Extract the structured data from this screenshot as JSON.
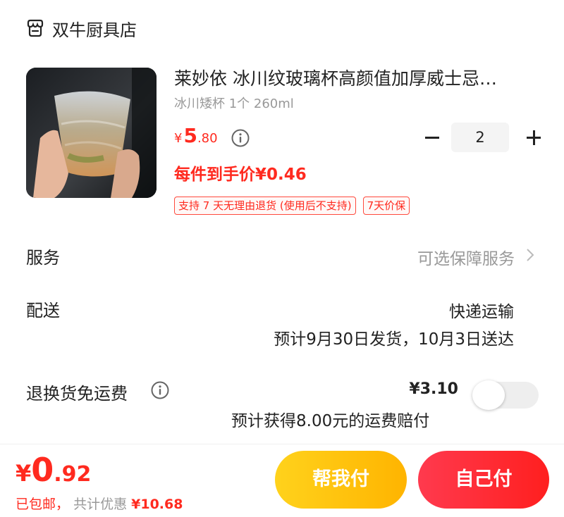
{
  "store": {
    "name": "双牛厨具店",
    "icon": "store-icon"
  },
  "product": {
    "title": "莱妙依 冰川纹玻璃杯高颜值加厚威士忌…",
    "variant": "冰川矮杯 1个 260ml",
    "price": {
      "currency": "¥",
      "integer": "5",
      "decimal": ".80"
    },
    "unit_price": "每件到手价¥0.46",
    "tags": [
      "支持 7 天无理由退货 (使用后不支持)",
      "7天价保"
    ],
    "quantity": "2"
  },
  "service": {
    "label": "服务",
    "value": "可选保障服务"
  },
  "delivery": {
    "label": "配送",
    "method": "快递运输",
    "estimate": "预计9月30日发货，10月3日送达"
  },
  "return_shipping": {
    "label": "退换货免运费",
    "price": "¥3.10",
    "note": "预计获得8.00元的运费赔付",
    "enabled": false
  },
  "footer": {
    "total": {
      "currency": "¥",
      "integer": "0",
      "decimal": ".92"
    },
    "shipping_note": "已包邮，",
    "discount_label": "共计优惠",
    "discount_amount": "¥10.68",
    "help_pay_label": "帮我付",
    "self_pay_label": "自己付"
  },
  "colors": {
    "accent": "#ff2a1f",
    "help_btn": "#ffc20e",
    "self_btn": "#ff2a35"
  }
}
